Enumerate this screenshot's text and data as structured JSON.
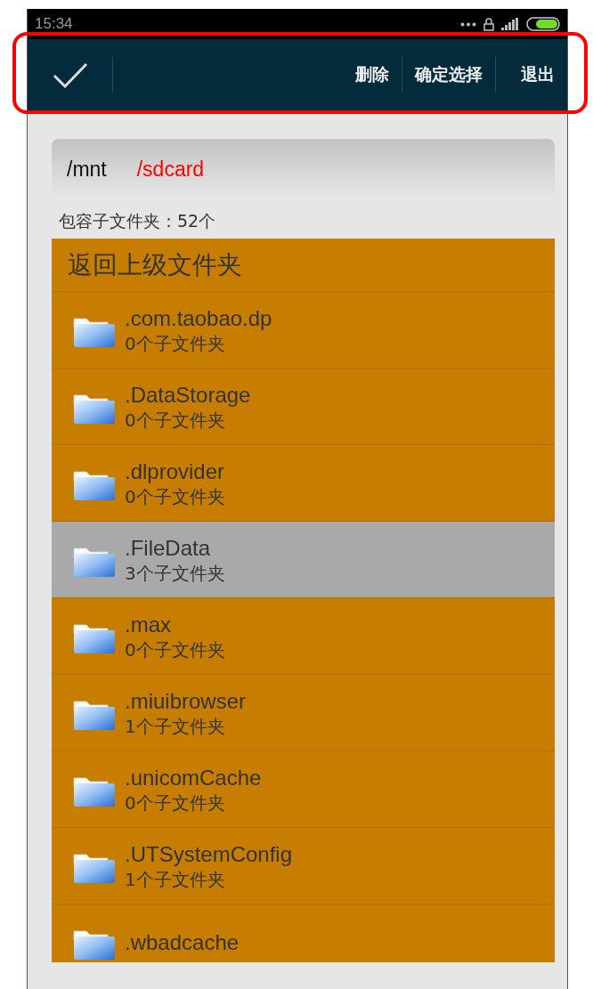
{
  "status_bar": {
    "time": "15:34"
  },
  "toolbar": {
    "actions": [
      "删除",
      "确定选择",
      "退出"
    ]
  },
  "path": {
    "segments": [
      {
        "text": "/mnt",
        "current": false
      },
      {
        "text": "/sdcard",
        "current": true
      }
    ]
  },
  "folder_count": "包容子文件夹：52个",
  "list": {
    "back": "返回上级文件夹",
    "items": [
      {
        "name": ".com.taobao.dp",
        "count": "0个子文件夹",
        "selected": false
      },
      {
        "name": ".DataStorage",
        "count": "0个子文件夹",
        "selected": false
      },
      {
        "name": ".dlprovider",
        "count": "0个子文件夹",
        "selected": false
      },
      {
        "name": ".FileData",
        "count": "3个子文件夹",
        "selected": true
      },
      {
        "name": ".max",
        "count": "0个子文件夹",
        "selected": false
      },
      {
        "name": ".miuibrowser",
        "count": "1个子文件夹",
        "selected": false
      },
      {
        "name": ".unicomCache",
        "count": "0个子文件夹",
        "selected": false
      },
      {
        "name": ".UTSystemConfig",
        "count": "1个子文件夹",
        "selected": false
      },
      {
        "name": ".wbadcache",
        "selected": false
      }
    ]
  }
}
